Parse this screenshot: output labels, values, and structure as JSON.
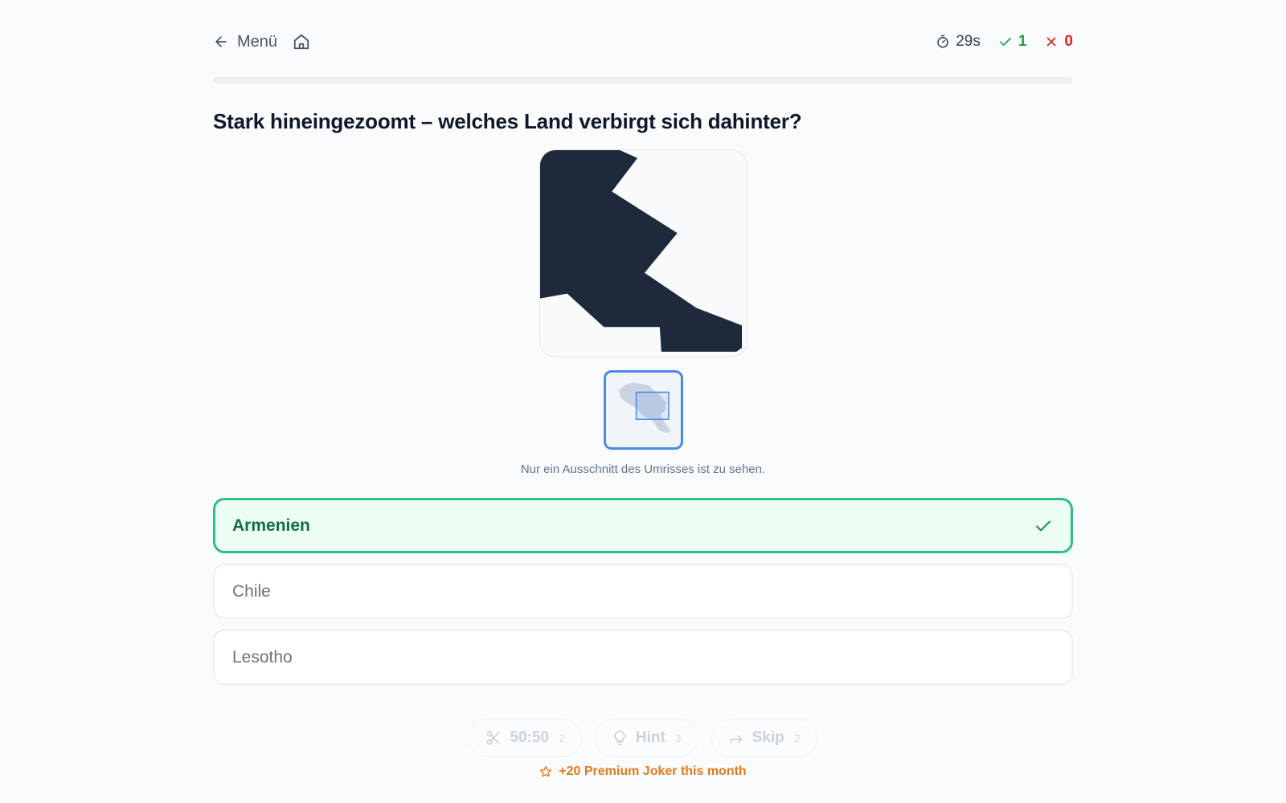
{
  "header": {
    "back_label": "Menü",
    "timer": "29s",
    "correct_count": "1",
    "wrong_count": "0"
  },
  "progress": 0,
  "question": "Stark hineingezoomt – welches Land verbirgt sich dahinter?",
  "caption": "Nur ein Ausschnitt des Umrisses ist zu sehen.",
  "options": [
    {
      "label": "Armenien",
      "state": "correct"
    },
    {
      "label": "Chile",
      "state": "neutral"
    },
    {
      "label": "Lesotho",
      "state": "neutral"
    }
  ],
  "jokers": [
    {
      "label": "50:50",
      "count": "2",
      "icon": "scissors-icon"
    },
    {
      "label": "Hint",
      "count": "3",
      "icon": "lightbulb-icon"
    },
    {
      "label": "Skip",
      "count": "2",
      "icon": "skip-arrow-icon"
    }
  ],
  "premium": "+20 Premium Joker this month",
  "colors": {
    "shape_fill": "#1e293b",
    "correct_border": "#2fbf84",
    "correct_bg": "#ecfdf3",
    "accent_blue": "#4a8be8",
    "premium": "#e07b1c"
  }
}
